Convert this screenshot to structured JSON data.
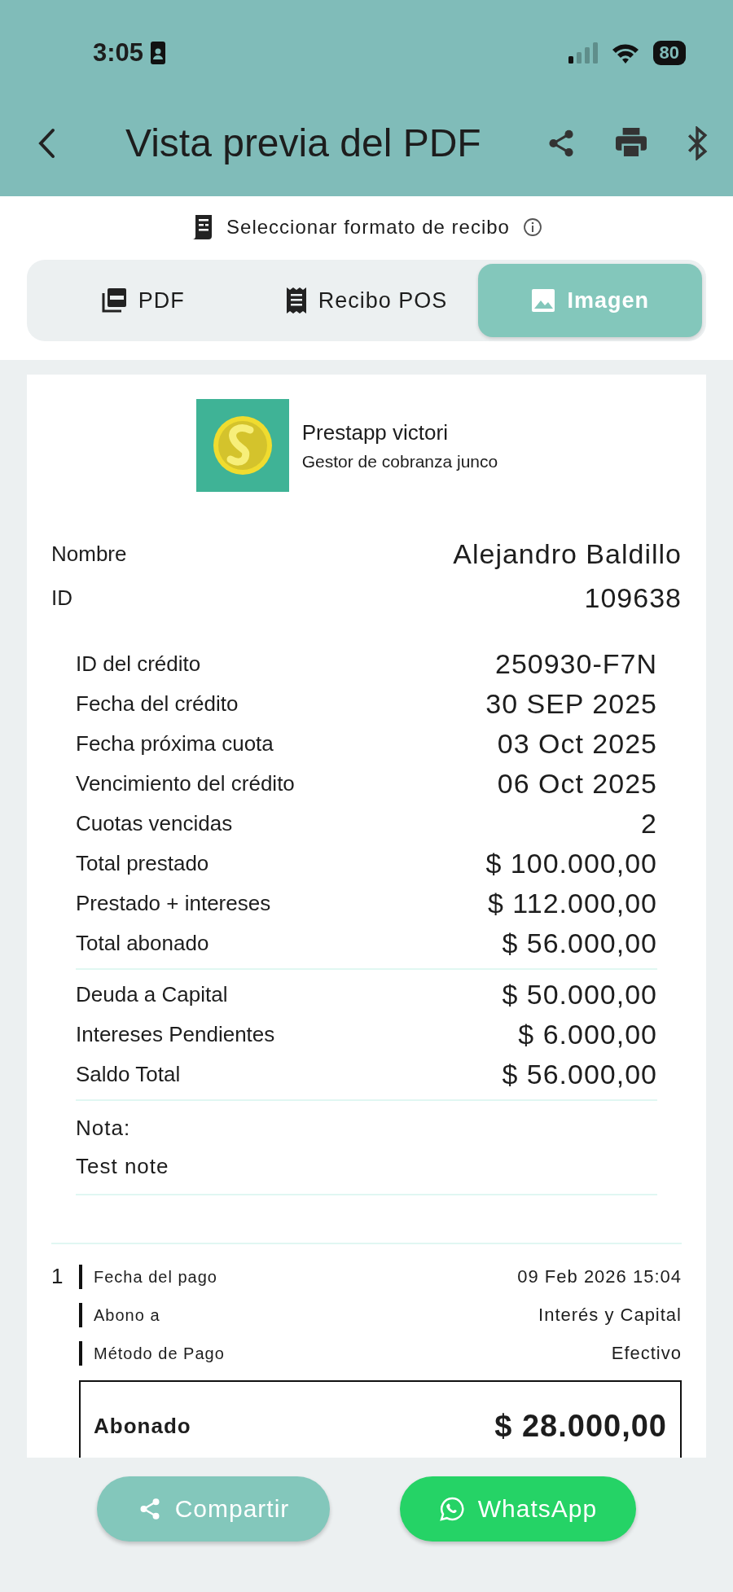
{
  "status_bar": {
    "time": "3:05",
    "battery": "80"
  },
  "app_bar": {
    "title": "Vista previa del PDF"
  },
  "format_selector": {
    "label": "Seleccionar formato de recibo",
    "options": [
      {
        "label": "PDF",
        "kind": "pdf",
        "selected": false
      },
      {
        "label": "Recibo POS",
        "kind": "pos",
        "selected": false
      },
      {
        "label": "Imagen",
        "kind": "image",
        "selected": true
      }
    ]
  },
  "receipt": {
    "company": "Prestapp victori",
    "subtitle": "Gestor de cobranza junco",
    "client": [
      {
        "label": "Nombre",
        "value": "Alejandro Baldillo"
      },
      {
        "label": "ID",
        "value": "109638"
      }
    ],
    "credit": [
      {
        "label": "ID del crédito",
        "value": "250930-F7N"
      },
      {
        "label": "Fecha del crédito",
        "value": "30 SEP 2025"
      },
      {
        "label": "Fecha próxima cuota",
        "value": "03 Oct 2025"
      },
      {
        "label": "Vencimiento del crédito",
        "value": "06 Oct 2025"
      },
      {
        "label": "Cuotas vencidas",
        "value": "2"
      },
      {
        "label": "Total prestado",
        "value": "$ 100.000,00"
      },
      {
        "label": "Prestado + intereses",
        "value": "$ 112.000,00"
      },
      {
        "label": "Total abonado",
        "value": "$ 56.000,00"
      }
    ],
    "balance": [
      {
        "label": "Deuda a Capital",
        "value": "$ 50.000,00"
      },
      {
        "label": "Intereses Pendientes",
        "value": "$ 6.000,00"
      },
      {
        "label": "Saldo Total",
        "value": "$ 56.000,00"
      }
    ],
    "note": {
      "label": "Nota:",
      "text": "Test note"
    },
    "payments": [
      {
        "number": "1",
        "rows": [
          {
            "label": "Fecha del pago",
            "value": "09 Feb 2026 15:04"
          },
          {
            "label": "Abono a",
            "value": "Interés y Capital"
          },
          {
            "label": "Método de Pago",
            "value": "Efectivo"
          }
        ],
        "total_label": "Abonado",
        "total_value": "$ 28.000,00"
      }
    ]
  },
  "actions": [
    {
      "label": "Compartir",
      "kind": "share"
    },
    {
      "label": "WhatsApp",
      "kind": "whatsapp"
    }
  ]
}
